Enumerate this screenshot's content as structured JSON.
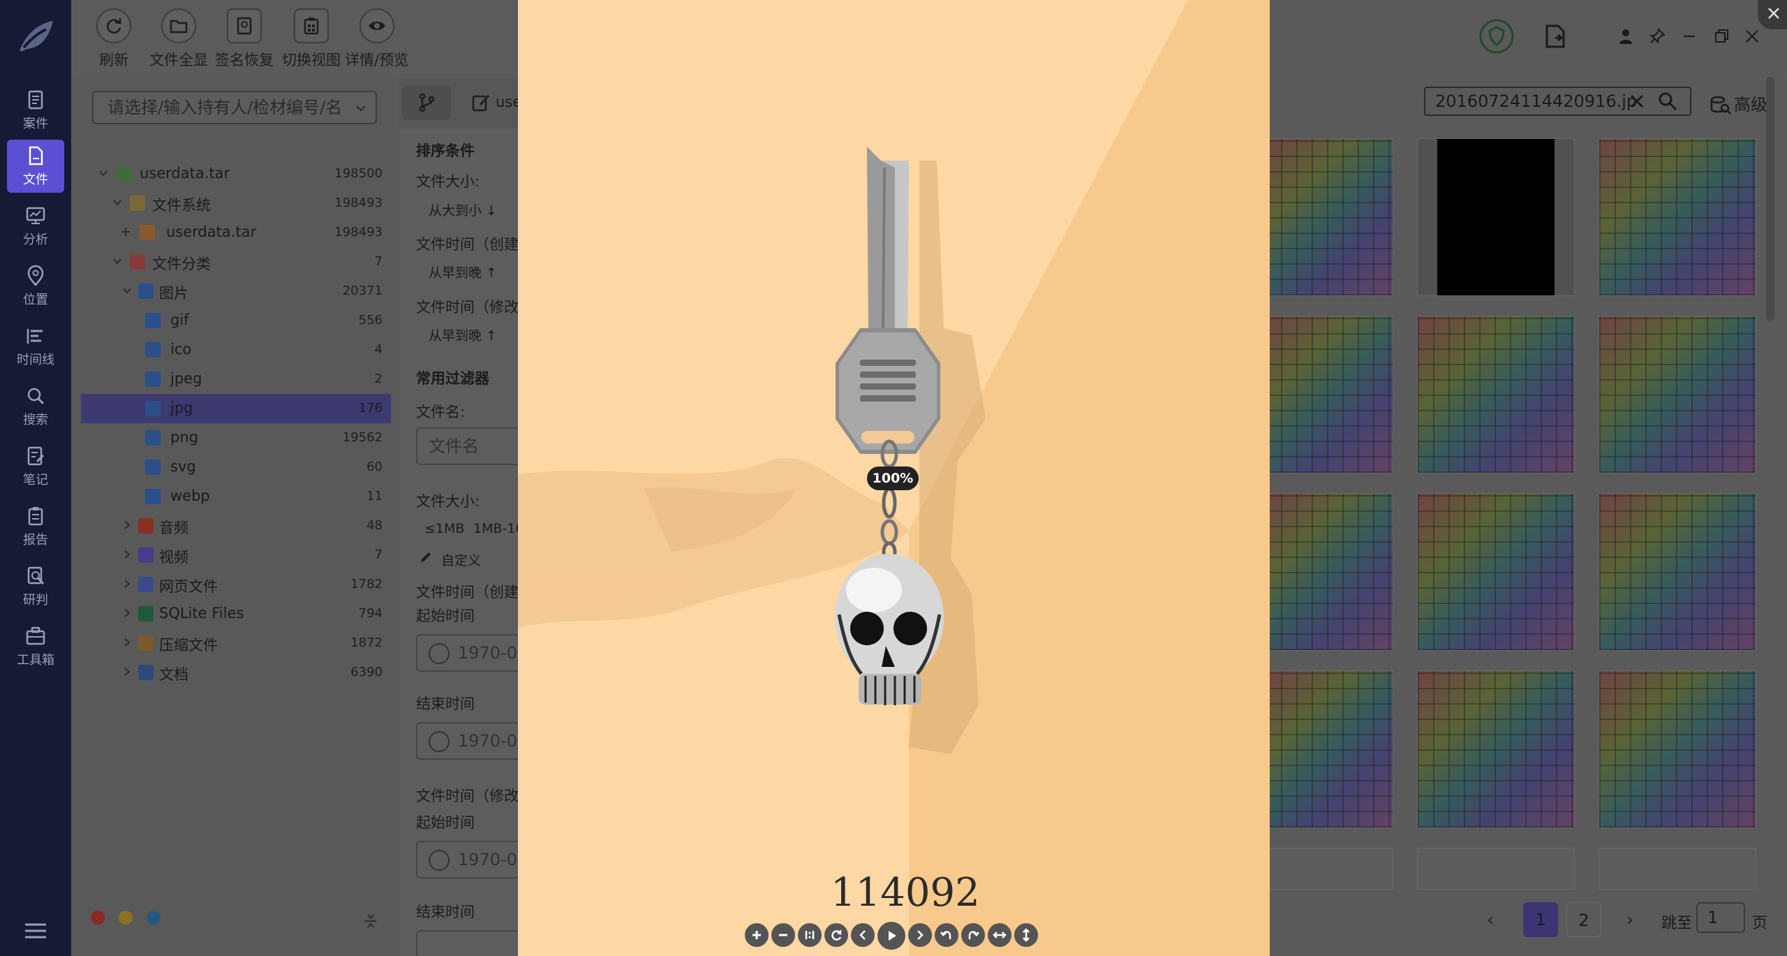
{
  "nav": {
    "items": [
      {
        "label": "案件",
        "icon": "case-icon"
      },
      {
        "label": "文件",
        "icon": "file-icon"
      },
      {
        "label": "分析",
        "icon": "analysis-icon"
      },
      {
        "label": "位置",
        "icon": "location-icon"
      },
      {
        "label": "时间线",
        "icon": "timeline-icon"
      },
      {
        "label": "搜索",
        "icon": "search-icon"
      },
      {
        "label": "笔记",
        "icon": "note-icon"
      },
      {
        "label": "报告",
        "icon": "report-icon"
      },
      {
        "label": "研判",
        "icon": "judge-icon"
      },
      {
        "label": "工具箱",
        "icon": "toolbox-icon"
      }
    ],
    "active": "文件"
  },
  "toolbar": {
    "refresh": "刷新",
    "show_all": "文件全显",
    "sig_recover": "签名恢复",
    "switch_view": "切换视图",
    "detail_preview": "详情/预览"
  },
  "tree": {
    "search_placeholder": "请选择/输入持有人/检材编号/名",
    "rows": [
      {
        "label": "userdata.tar",
        "count": "198500"
      },
      {
        "label": "文件系统",
        "count": "198493"
      },
      {
        "label": "userdata.tar",
        "count": "198493"
      },
      {
        "label": "文件分类",
        "count": "7"
      },
      {
        "label": "图片",
        "count": "20371"
      },
      {
        "label": "gif",
        "count": "556"
      },
      {
        "label": "ico",
        "count": "4"
      },
      {
        "label": "jpeg",
        "count": "2"
      },
      {
        "label": "jpg",
        "count": "176"
      },
      {
        "label": "png",
        "count": "19562"
      },
      {
        "label": "svg",
        "count": "60"
      },
      {
        "label": "webp",
        "count": "11"
      },
      {
        "label": "音频",
        "count": "48"
      },
      {
        "label": "视频",
        "count": "7"
      },
      {
        "label": "网页文件",
        "count": "1782"
      },
      {
        "label": "SQLite Files",
        "count": "794"
      },
      {
        "label": "压缩文件",
        "count": "1872"
      },
      {
        "label": "文档",
        "count": "6390"
      }
    ],
    "status_colors": [
      "#c0392b",
      "#c9a227",
      "#2e86c1"
    ]
  },
  "filter": {
    "tab_label": "use",
    "sort_title": "排序条件",
    "size_label": "文件大小:",
    "size_sort": "从大到小 ↓",
    "ctime_label": "文件时间（创建",
    "ctime_sort": "从早到晚 ↑",
    "mtime_label": "文件时间（修改",
    "mtime_sort": "从早到晚 ↑",
    "common_title": "常用过滤器",
    "name_label": "文件名:",
    "name_placeholder": "文件名",
    "size2_label": "文件大小:",
    "size_opt1": "≤1MB",
    "size_opt2": "1MB-10",
    "custom": "自定义",
    "ctime2_label": "文件时间（创建",
    "start_label": "起始时间",
    "date_placeholder": "1970-0",
    "end_label": "结束时间",
    "mtime2_label": "文件时间（修改",
    "start2_label": "起始时间",
    "end2_label": "结束时间"
  },
  "grid": {
    "search_value": "20160724114420916.jp",
    "advanced": "高级",
    "pages": [
      "1",
      "2"
    ],
    "current_page": "1",
    "jump_label": "跳至",
    "jump_value": "1",
    "page_suffix": "页"
  },
  "viewer": {
    "zoom": "100%",
    "counter": "114092",
    "controls": [
      "zoom-in-icon",
      "zoom-out-icon",
      "actual-size-icon",
      "reset-icon",
      "prev-icon",
      "play-icon",
      "next-icon",
      "rotate-left-icon",
      "rotate-right-icon",
      "flip-horizontal-icon",
      "flip-vertical-icon"
    ],
    "bg_color": "#fdd8a4"
  }
}
